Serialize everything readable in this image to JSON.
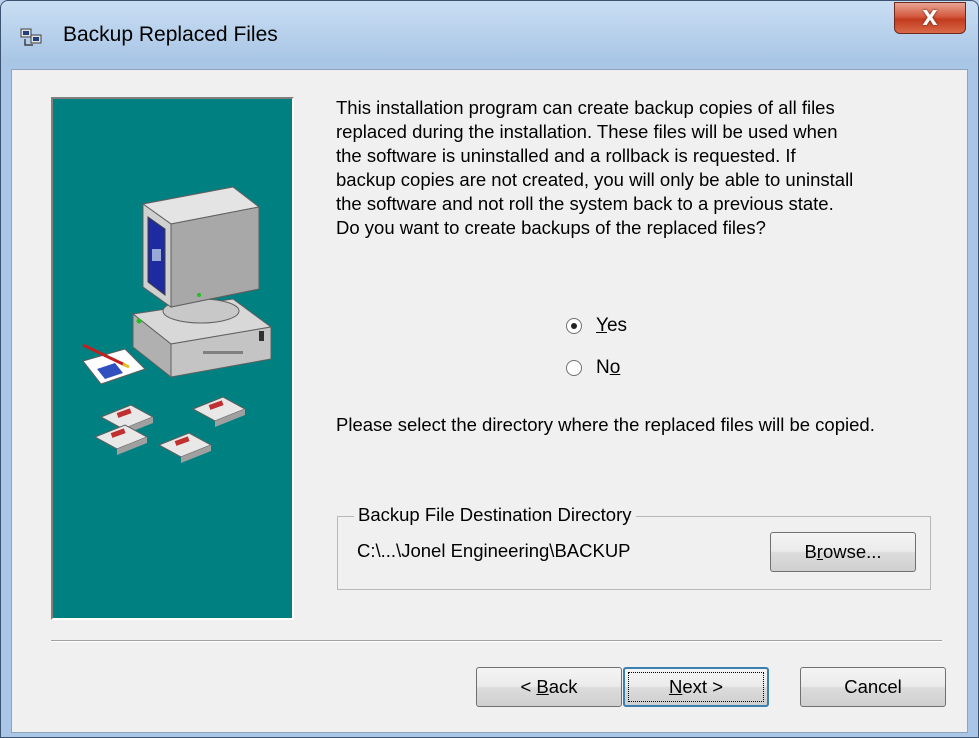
{
  "window": {
    "title": "Backup Replaced Files",
    "close_label": "X"
  },
  "intro_text": "This installation program can create backup copies of all files\nreplaced during the installation. These files will be used when\nthe software is uninstalled and a rollback is requested.  If\nbackup copies are not created, you will only be able to uninstall\nthe software and not roll the system back to a previous state.\nDo you want to create backups of the replaced files?",
  "options": {
    "yes": {
      "label_first": "Y",
      "label_rest": "es",
      "checked": true
    },
    "no": {
      "label_first": "N",
      "label_underlined": "o",
      "checked": false
    }
  },
  "directory_prompt": "Please select the directory where the replaced  files will be copied.",
  "destination": {
    "group_label": "Backup File Destination Directory",
    "path": "C:\\...\\Jonel Engineering\\BACKUP",
    "browse_first": "B",
    "browse_underlined": "r",
    "browse_rest": "owse..."
  },
  "buttons": {
    "back_prefix": "< ",
    "back_underlined": "B",
    "back_rest": "ack",
    "next_underlined": "N",
    "next_rest": "ext >",
    "cancel": "Cancel"
  },
  "colors": {
    "side_panel": "#008080",
    "close_button": "#c9432a"
  },
  "icons": [
    "installer-app-icon",
    "close-icon",
    "computer-illustration",
    "floppy-disk-icon"
  ]
}
